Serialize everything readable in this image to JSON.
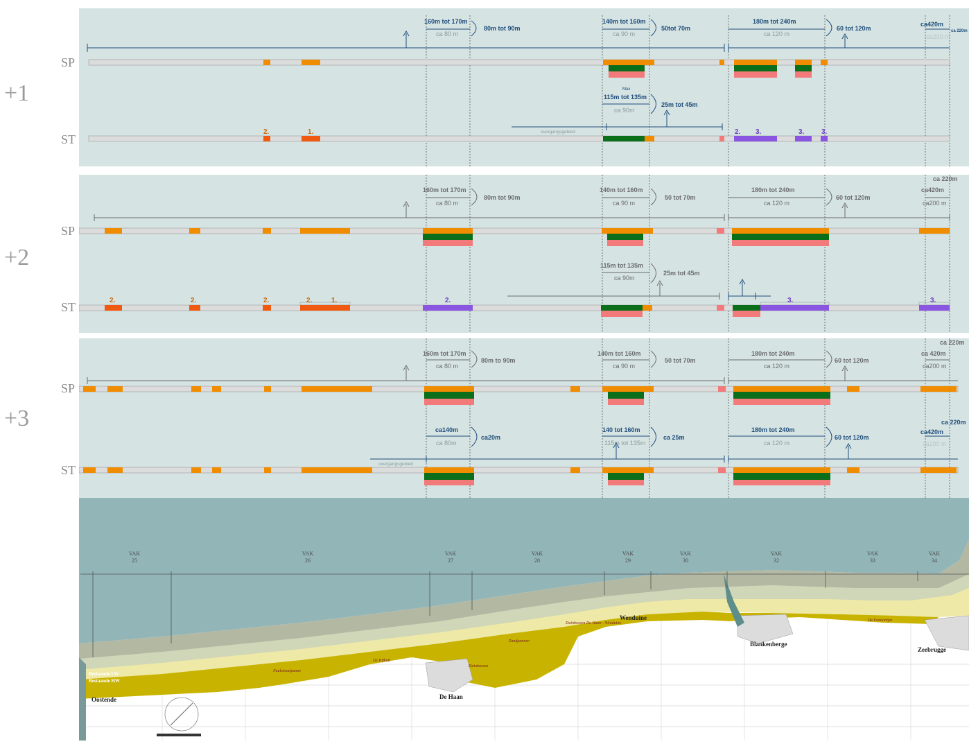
{
  "levels": {
    "l1": "+1",
    "l2": "+2",
    "l3": "+3",
    "sp": "SP",
    "st": "ST"
  },
  "colors": {
    "panel": "#d6e3e3",
    "track": "#dcdcdc",
    "track_edge": "#9a9a9a",
    "orange": "#f08c00",
    "red_orange": "#f05a10",
    "green": "#0b6e1a",
    "pink": "#f27a7a",
    "purple": "#8a55e0",
    "dim_blue": "#1e4d7a",
    "dim_gray": "#8a9a9a",
    "sea": "#92b5b8",
    "beach": "#efe9a8",
    "dune": "#c8b400",
    "land": "#ffffff",
    "text_gray": "#6b6b6b"
  },
  "p1_sp": {
    "d1": "160m tot 170m",
    "c1": "ca 80 m",
    "r1": "80m tot 90m",
    "d2": "140m tot 160m",
    "c2": "ca 90 m",
    "r2": "50tot 70m",
    "d3": "180m tot 240m",
    "c3": "ca 120 m",
    "r3": "60 tot 120m",
    "d4": "ca420m",
    "c4": "ca200 m",
    "e4": "ca 220m"
  },
  "p1_st": {
    "max": "Max",
    "d1": "115m tot 135m",
    "c1": "ca 90m",
    "r1": "25m tot 45m",
    "trans": "overgangsgebied",
    "n2a": "2.",
    "n1": "1.",
    "n2b": "2.",
    "n3a": "3.",
    "n3b": "3.",
    "n3c": "3."
  },
  "p2_sp": {
    "d1": "160m tot 170m",
    "c1": "ca 80 m",
    "r1": "80m tot 90m",
    "d2": "140m tot 160m",
    "c2": "ca 90 m",
    "r2": "50 tot 70m",
    "d3": "180m tot 240m",
    "c3": "ca 120 m",
    "r3": "60 tot 120m",
    "d4": "ca420m",
    "c4": "ca200 m",
    "e4": "ca 220m"
  },
  "p2_st": {
    "d1": "115m tot 135m",
    "c1": "ca 90m",
    "r1": "25m tot 45m",
    "n2a": "2.",
    "n2b": "2.",
    "n2c": "2.",
    "n2d": "2.",
    "n1": "1.",
    "n2e": "2.",
    "n3a": "3.",
    "n3b": "3."
  },
  "p3_sp": {
    "d1": "160m tot 170m",
    "c1": "ca 80 m",
    "r1": "80m to 90m",
    "d2": "140m tot 160m",
    "c2": "ca 90 m",
    "r2": "50 tot 70m",
    "d3": "180m tot 240m",
    "c3": "ca 120 m",
    "r3": "60 tot 120m",
    "d4": "ca 420m",
    "c4": "ca200 m",
    "e4": "ca 220m"
  },
  "p3_st": {
    "d1": "ca140m",
    "c1": "ca 80m",
    "r1": "ca20m",
    "d2": "140 tot 160m",
    "c2": "115m tot 135m",
    "r2": "ca 25m",
    "d3": "180m tot 240m",
    "c3": "ca 120 m",
    "r3": "60 tot 120m",
    "d4": "ca420m",
    "c4": "ca200 m",
    "e4": "ca 220m",
    "trans": "overgangsgebied"
  },
  "map": {
    "vak_label": "VAK",
    "vak_numbers": [
      "25",
      "26",
      "27",
      "28",
      "29",
      "30",
      "32",
      "33",
      "34"
    ],
    "towns": [
      "Oostende",
      "De Haan",
      "Wenduine",
      "Blankenberge",
      "Zeebrugge"
    ],
    "areas": [
      "Paulstraatpanne",
      "De Kijkuit",
      "Zandpannen",
      "Duinbossen",
      "Duinbossen De Haan - Wenduine",
      "De Fonteintjes"
    ],
    "legend": [
      "Bestaande LW",
      "Bestaande HW"
    ]
  }
}
